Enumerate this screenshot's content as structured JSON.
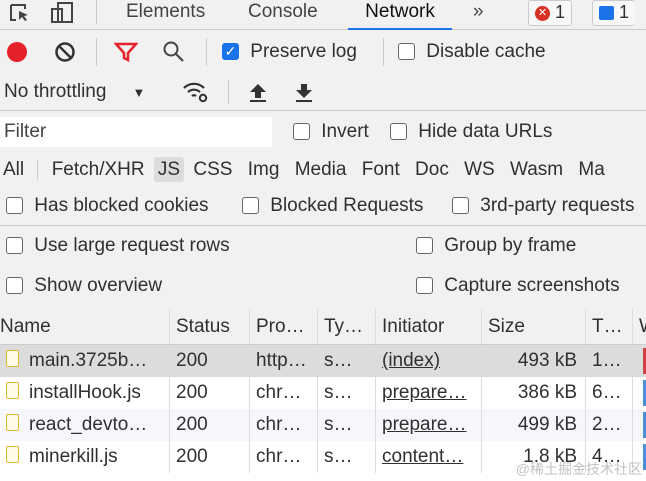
{
  "tabs": {
    "items": [
      "Elements",
      "Console",
      "Network"
    ],
    "more": "»",
    "active": "Network",
    "errors": "1",
    "messages": "1"
  },
  "toolbar": {
    "preserve_log": "Preserve log",
    "preserve_log_checked": true,
    "disable_cache": "Disable cache",
    "throttling": "No throttling"
  },
  "filter": {
    "placeholder": "Filter",
    "invert": "Invert",
    "hide_data_urls": "Hide data URLs"
  },
  "types": [
    "All",
    "Fetch/XHR",
    "JS",
    "CSS",
    "Img",
    "Media",
    "Font",
    "Doc",
    "WS",
    "Wasm",
    "Ma"
  ],
  "active_type": "JS",
  "options": {
    "blocked_cookies": "Has blocked cookies",
    "blocked_requests": "Blocked Requests",
    "third_party": "3rd-party requests",
    "large_rows": "Use large request rows",
    "group_by_frame": "Group by frame",
    "show_overview": "Show overview",
    "capture_screenshots": "Capture screenshots"
  },
  "table": {
    "headers": [
      "Name",
      "Status",
      "Pro…",
      "Ty…",
      "Initiator",
      "Size",
      "T…",
      "W"
    ],
    "rows": [
      {
        "name": "main.3725b…",
        "status": "200",
        "protocol": "http…",
        "type": "s…",
        "initiator": "(index)",
        "size": "493 kB",
        "time": "1…"
      },
      {
        "name": "installHook.js",
        "status": "200",
        "protocol": "chr…",
        "type": "s…",
        "initiator": "prepare…",
        "size": "386 kB",
        "time": "6…"
      },
      {
        "name": "react_devto…",
        "status": "200",
        "protocol": "chr…",
        "type": "s…",
        "initiator": "prepare…",
        "size": "499 kB",
        "time": "2…"
      },
      {
        "name": "minerkill.js",
        "status": "200",
        "protocol": "chr…",
        "type": "s…",
        "initiator": "content…",
        "size": "1.8 kB",
        "time": "4…"
      }
    ]
  },
  "watermark": "@稀土掘金技术社区"
}
